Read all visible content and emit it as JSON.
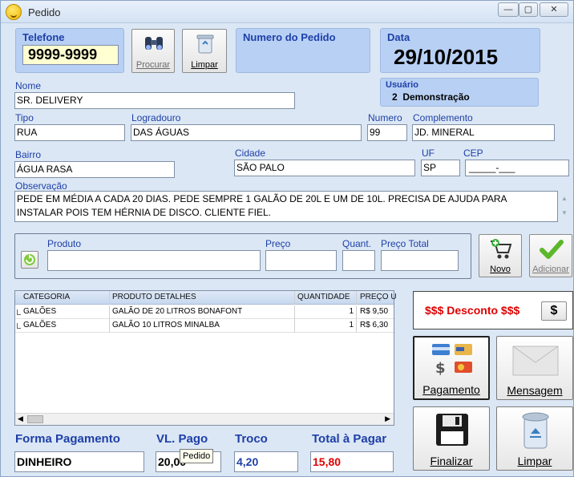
{
  "window": {
    "title": "Pedido",
    "minimize": "—",
    "maximize": "▢",
    "close": "✕"
  },
  "telefone": {
    "label": "Telefone",
    "value": "9999-9999"
  },
  "buttons": {
    "procurar": "Procurar",
    "limpar_top": "Limpar",
    "novo": "Novo",
    "adicionar": "Adicionar",
    "desconto_symbol": "$",
    "pagamento": "Pagamento",
    "mensagem": "Mensagem",
    "finalizar": "Finalizar",
    "limpar": "Limpar"
  },
  "pedido": {
    "label": "Numero do Pedido"
  },
  "data": {
    "label": "Data",
    "value": "29/10/2015"
  },
  "usuario": {
    "label": "Usuário",
    "value": "2  Demonstração"
  },
  "nome": {
    "label": "Nome",
    "value": "SR. DELIVERY"
  },
  "tipo": {
    "label": "Tipo",
    "value": "RUA"
  },
  "logradouro": {
    "label": "Logradouro",
    "value": "DAS ÁGUAS"
  },
  "numero": {
    "label": "Numero",
    "value": "99"
  },
  "complemento": {
    "label": "Complemento",
    "value": "JD. MINERAL"
  },
  "bairro": {
    "label": "Bairro",
    "value": "ÁGUA RASA"
  },
  "cidade": {
    "label": "Cidade",
    "value": "SÃO PALO"
  },
  "uf": {
    "label": "UF",
    "value": "SP"
  },
  "cep": {
    "label": "CEP",
    "value": "_____-___"
  },
  "observacao": {
    "label": "Observação",
    "value": "PEDE EM MÉDIA A CADA 20 DIAS.  PEDE SEMPRE 1 GALÃO DE 20L E UM DE 10L. PRECISA DE AJUDA PARA INSTALAR POIS TEM HÉRNIA DE DISCO. CLIENTE FIEL."
  },
  "item_entry": {
    "produto": "Produto",
    "preco": "Preço",
    "quant": "Quant.",
    "preco_total": "Preço Total"
  },
  "grid": {
    "columns": [
      "CATEGORIA",
      "PRODUTO DETALHES",
      "QUANTIDADE",
      "PREÇO U"
    ],
    "rows": [
      {
        "categoria": "GALÕES",
        "produto": "GALÃO DE 20 LITROS BONAFONT",
        "quantidade": "1",
        "preco": "R$ 9,50"
      },
      {
        "categoria": "GALÕES",
        "produto": "GALÃO 10 LITROS MINALBA",
        "quantidade": "1",
        "preco": "R$ 6,30"
      }
    ]
  },
  "desconto": {
    "label": "$$$ Desconto $$$"
  },
  "footer": {
    "forma_label": "Forma Pagamento",
    "forma_value": "DINHEIRO",
    "vlpago_label": "VL. Pago",
    "vlpago_value": "20,00",
    "troco_label": "Troco",
    "troco_value": "4,20",
    "total_label": "Total à Pagar",
    "total_value": "15,80",
    "tooltip": "Pedido"
  },
  "colors": {
    "label_blue": "#1e3fa8",
    "total_red": "#e00000",
    "panel_blue": "#b8d0f4"
  }
}
